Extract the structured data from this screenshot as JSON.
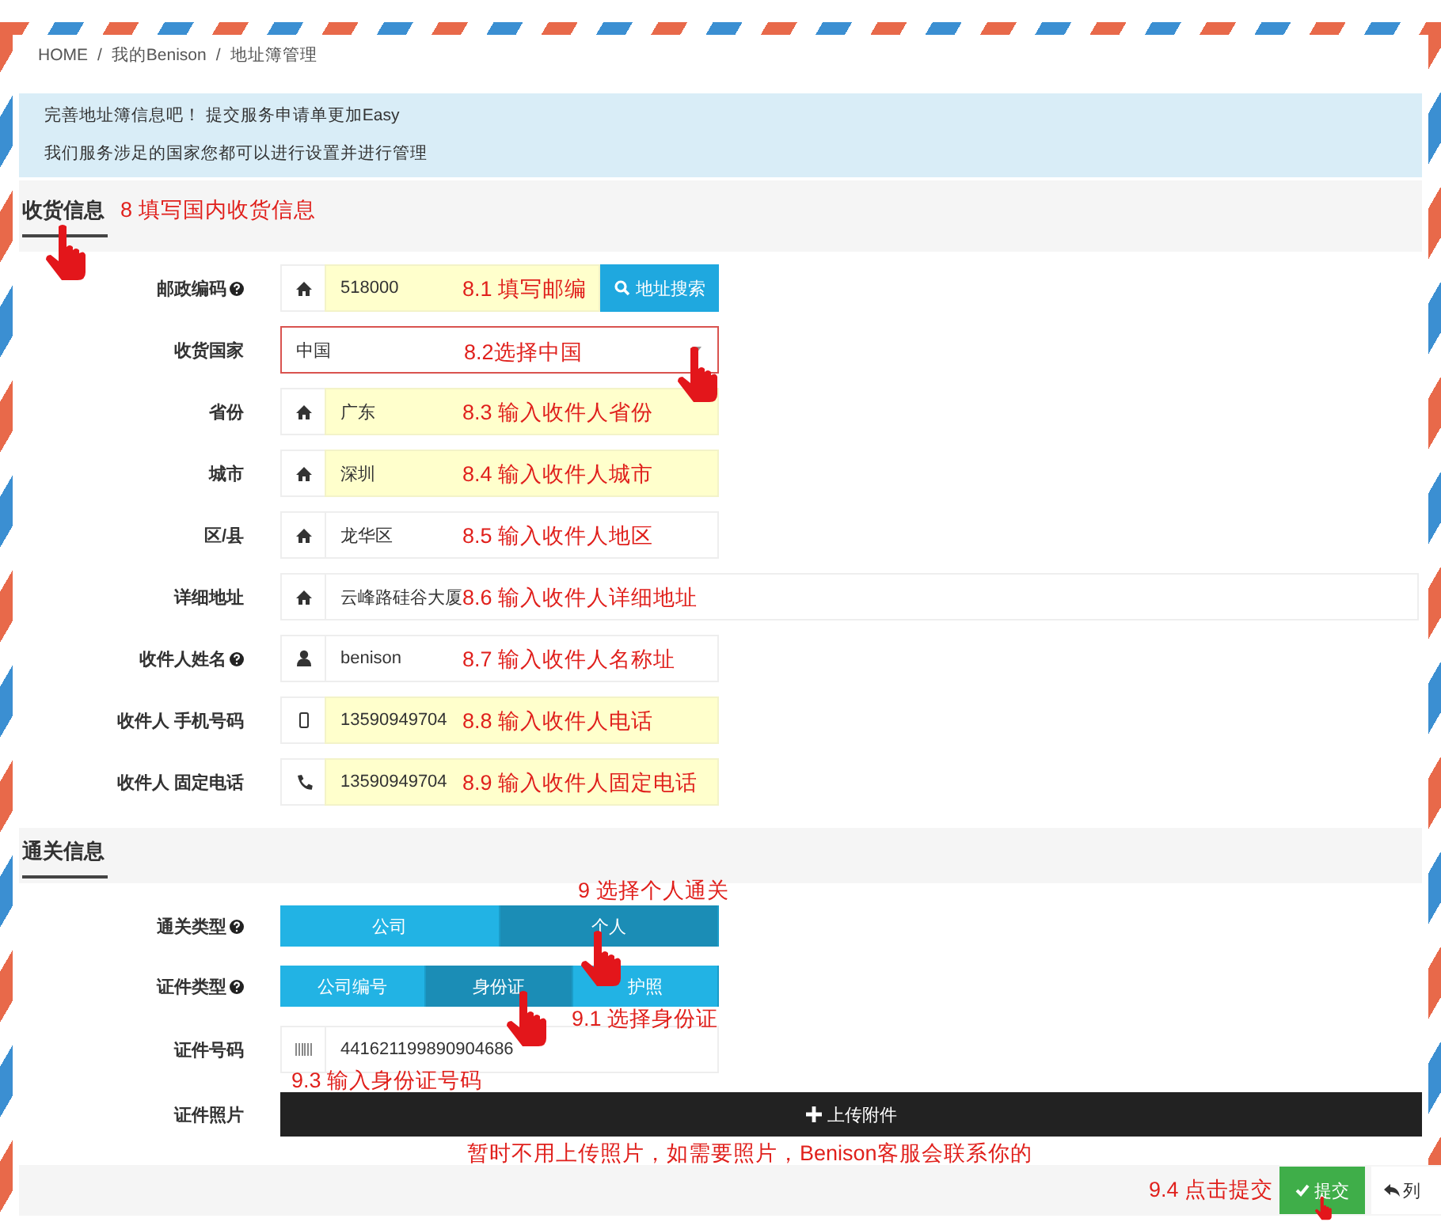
{
  "breadcrumb": {
    "items": [
      "HOME",
      "我的Benison",
      "地址簿管理"
    ],
    "separator": "/"
  },
  "notice": [
    "完善地址簿信息吧！ 提交服务申请单更加Easy",
    "我们服务涉足的国家您都可以进行设置并进行管理"
  ],
  "sections": [
    {
      "title": "收货信息",
      "annotation": "8 填写国内收货信息",
      "hand": true,
      "rows": [
        {
          "kind": "input",
          "label": "邮政编码",
          "help": true,
          "value": "518000",
          "highlighted": true,
          "annotation": "8.1 填写邮编",
          "button": "地址搜索",
          "wide": false,
          "hand": false
        },
        {
          "kind": "select",
          "label": "收货国家",
          "help": false,
          "value": "中国",
          "annotation": "8.2选择中国",
          "hand": true
        },
        {
          "kind": "input",
          "label": "省份",
          "help": false,
          "value": "广东",
          "highlighted": true,
          "annotation": "8.3 输入收件人省份",
          "wide": false,
          "hand": false
        },
        {
          "kind": "input",
          "label": "城市",
          "help": false,
          "value": "深圳",
          "highlighted": true,
          "annotation": "8.4 输入收件人城市",
          "wide": false,
          "hand": false
        },
        {
          "kind": "input",
          "label": "区/县",
          "help": false,
          "value": "龙华区",
          "highlighted": false,
          "annotation": "8.5 输入收件人地区",
          "wide": false,
          "hand": false
        },
        {
          "kind": "input",
          "label": "详细地址",
          "help": false,
          "value": "云峰路硅谷大厦",
          "highlighted": false,
          "annotation": "8.6 输入收件人详细地址",
          "wide": true,
          "hand": false
        },
        {
          "kind": "input",
          "label": "收件人姓名",
          "help": true,
          "value": "benison",
          "highlighted": false,
          "annotation": "8.7 输入收件人名称址",
          "wide": false,
          "hand": false
        },
        {
          "kind": "input",
          "label": "收件人 手机号码",
          "help": false,
          "value": "13590949704",
          "highlighted": true,
          "annotation": "8.8 输入收件人电话",
          "wide": false,
          "hand": false
        },
        {
          "kind": "input",
          "label": "收件人 固定电话",
          "help": false,
          "value": "13590949704",
          "highlighted": true,
          "annotation": "8.9 输入收件人固定电话",
          "wide": false,
          "hand": false
        }
      ]
    },
    {
      "title": "通关信息",
      "hand": false,
      "rows": [
        {
          "kind": "segmented",
          "label": "通关类型",
          "help": true,
          "annotation": "9 选择个人通关",
          "hand": false,
          "options": [
            {
              "label": "公司",
              "selected": false,
              "hand": false
            },
            {
              "label": "个人",
              "selected": true,
              "hand": true
            }
          ]
        },
        {
          "kind": "segmented",
          "label": "证件类型",
          "help": true,
          "annotation": "9.1 选择身份证",
          "hand": false,
          "options": [
            {
              "label": "公司编号",
              "selected": false,
              "hand": false
            },
            {
              "label": "身份证",
              "selected": true,
              "hand": true
            },
            {
              "label": "护照",
              "selected": false,
              "hand": false
            }
          ]
        },
        {
          "kind": "input",
          "label": "证件号码",
          "help": false,
          "value": "441621199890904686",
          "highlighted": false,
          "annotation": "9.3 输入身份证号码",
          "wide": false,
          "hand": false
        },
        {
          "kind": "upload",
          "label": "证件照片",
          "help": false,
          "button": "上传附件",
          "annotation": "暂时不用上传照片，如需要照片，Benison客服会联系你的",
          "hand": false
        }
      ]
    }
  ],
  "footer": {
    "annotation": "9.4 点击提交",
    "submit": {
      "label": "提交",
      "hand": true
    },
    "back": "列"
  }
}
